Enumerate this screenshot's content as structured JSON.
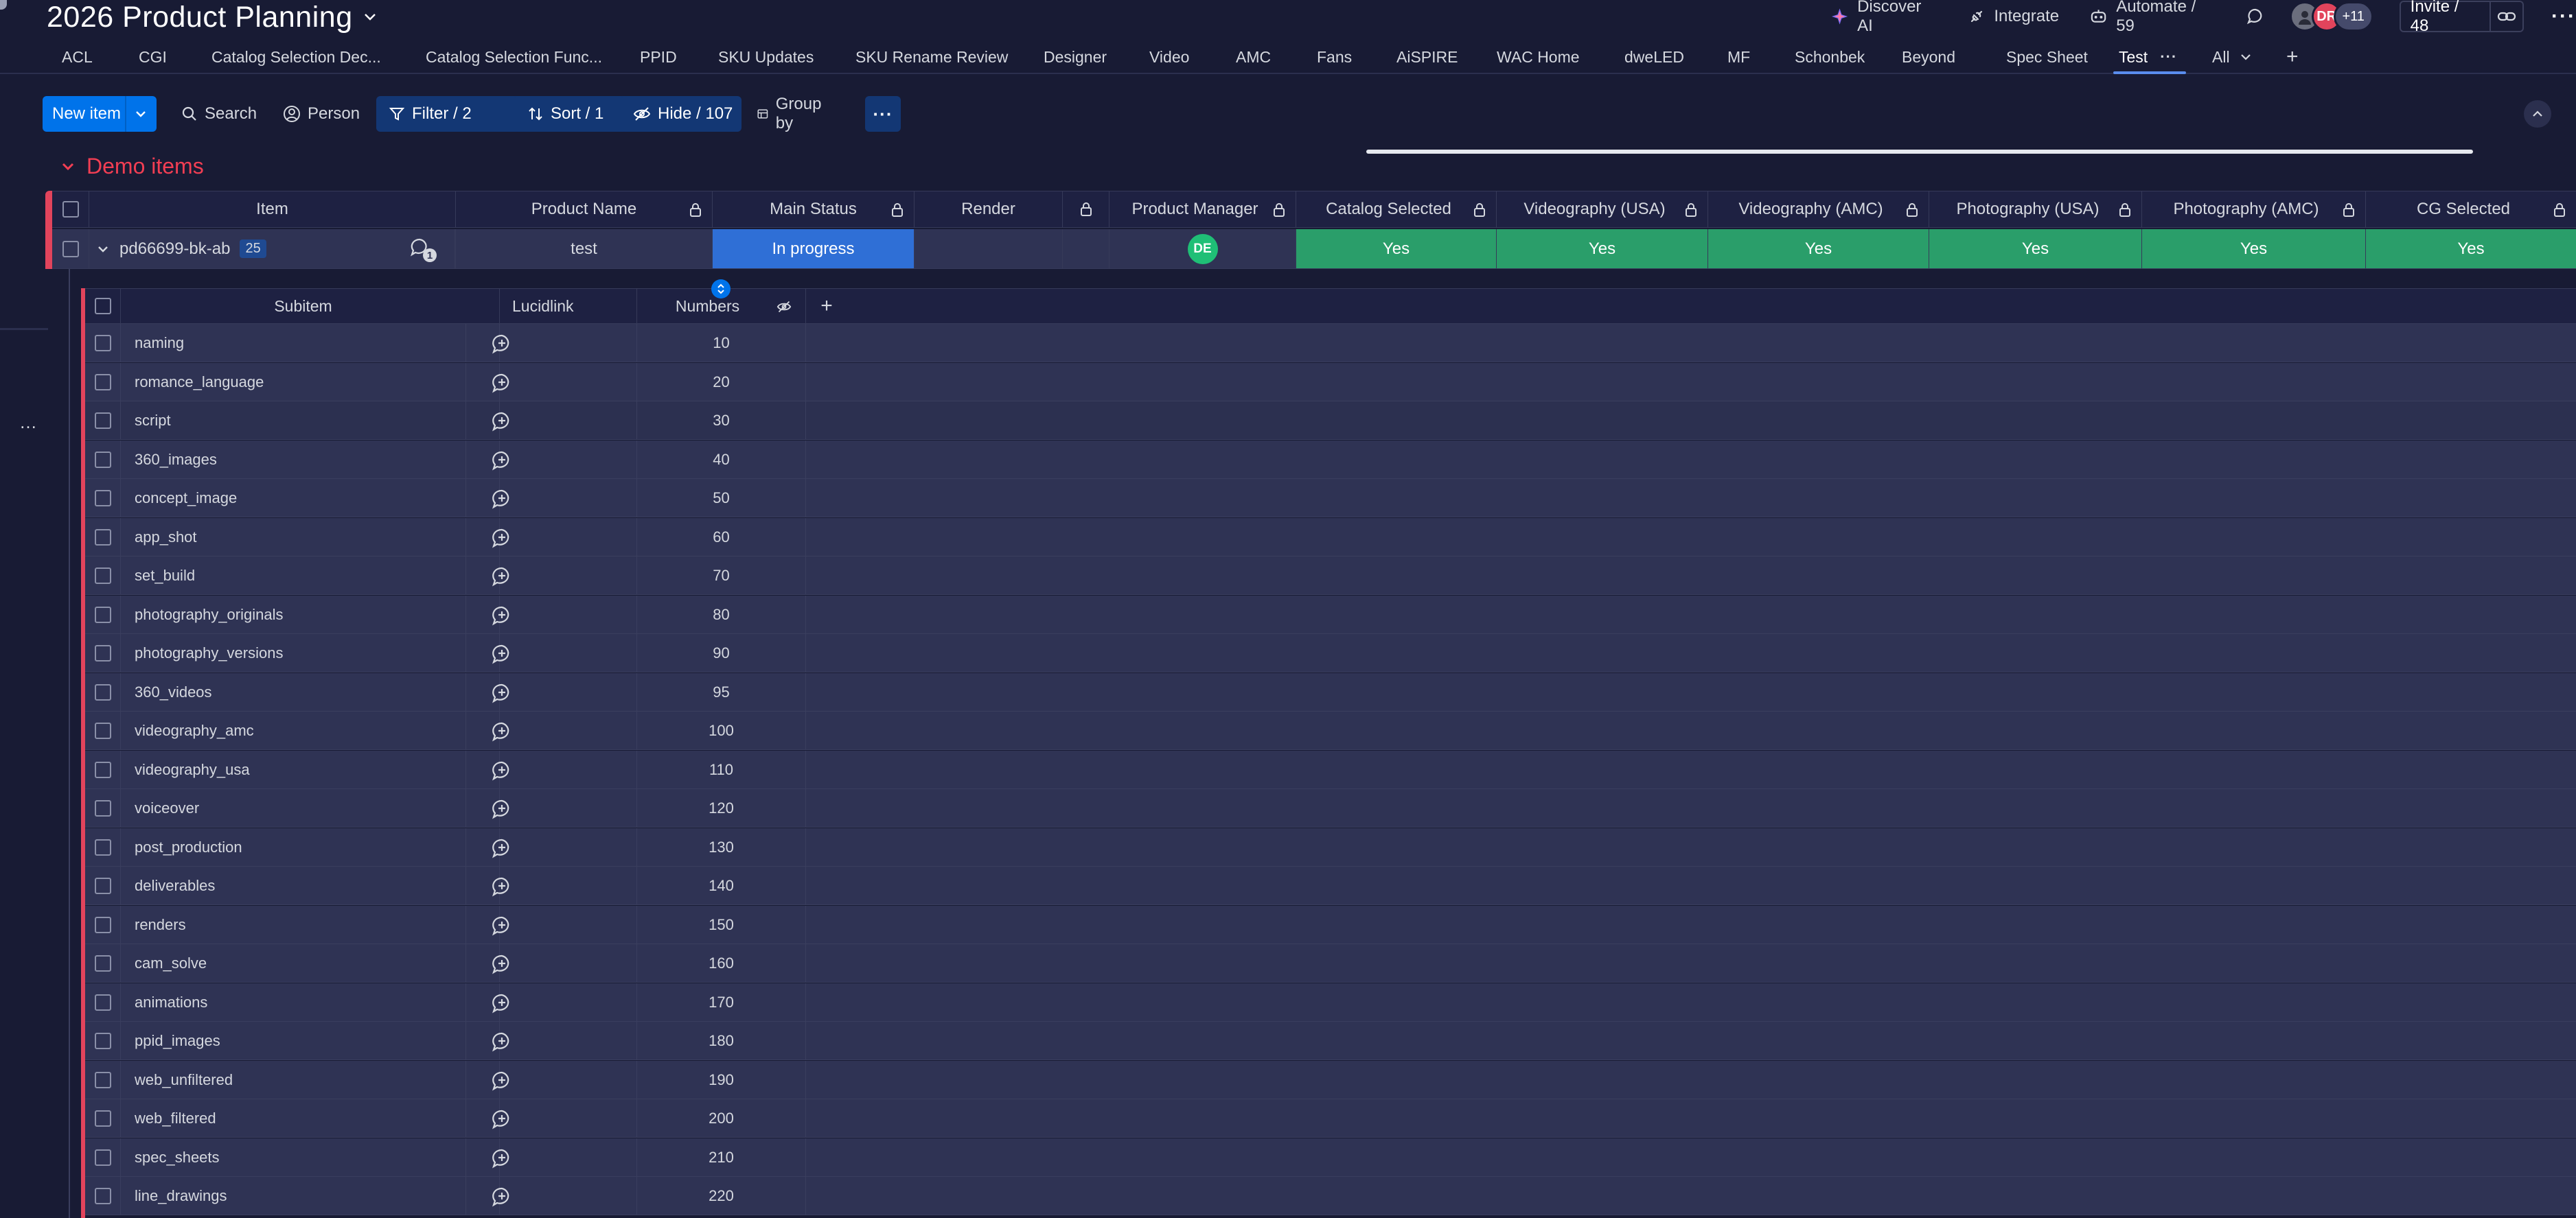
{
  "header": {
    "board_title": "2026 Product Planning",
    "discover_ai": "Discover AI",
    "integrate": "Integrate",
    "automate": "Automate / 59",
    "avatar_initials": "DR",
    "avatar_more": "+11",
    "invite": "Invite / 48"
  },
  "tabs": [
    "ACL",
    "CGI",
    "Catalog Selection Dec...",
    "Catalog Selection Func...",
    "PPID",
    "SKU Updates",
    "SKU Rename Review",
    "Designer",
    "Video",
    "AMC",
    "Fans",
    "AiSPIRE",
    "WAC Home",
    "dweLED",
    "MF",
    "Schonbek",
    "Beyond",
    "Spec Sheet",
    "Test",
    "All"
  ],
  "toolbar": {
    "new_item": "New item",
    "search": "Search",
    "person": "Person",
    "filter": "Filter / 2",
    "sort": "Sort / 1",
    "hide": "Hide / 107",
    "group_by": "Group by"
  },
  "group": {
    "title": "Demo items"
  },
  "columns": [
    "Item",
    "Product Name",
    "Main Status",
    "Render",
    "Product Manager",
    "Catalog Selected",
    "Videography (USA)",
    "Videography (AMC)",
    "Photography (USA)",
    "Photography (AMC)",
    "CG Selected"
  ],
  "item": {
    "name": "pd66699-bk-ab",
    "subitem_count": "25",
    "update_count": "1",
    "product_name": "test",
    "main_status": "In progress",
    "render": "",
    "manager_initials": "DE",
    "catalog_selected": "Yes",
    "videography_usa": "Yes",
    "videography_amc": "Yes",
    "photography_usa": "Yes",
    "photography_amc": "Yes",
    "cg_selected": "Yes"
  },
  "sub_columns": [
    "Subitem",
    "Lucidlink",
    "Numbers"
  ],
  "subitems": [
    {
      "name": "naming",
      "lucidlink": "",
      "number": "10"
    },
    {
      "name": "romance_language",
      "lucidlink": "",
      "number": "20"
    },
    {
      "name": "script",
      "lucidlink": "",
      "number": "30"
    },
    {
      "name": "360_images",
      "lucidlink": "",
      "number": "40"
    },
    {
      "name": "concept_image",
      "lucidlink": "",
      "number": "50"
    },
    {
      "name": "app_shot",
      "lucidlink": "",
      "number": "60"
    },
    {
      "name": "set_build",
      "lucidlink": "",
      "number": "70"
    },
    {
      "name": "photography_originals",
      "lucidlink": "",
      "number": "80"
    },
    {
      "name": "photography_versions",
      "lucidlink": "",
      "number": "90"
    },
    {
      "name": "360_videos",
      "lucidlink": "",
      "number": "95"
    },
    {
      "name": "videography_amc",
      "lucidlink": "",
      "number": "100"
    },
    {
      "name": "videography_usa",
      "lucidlink": "",
      "number": "110"
    },
    {
      "name": "voiceover",
      "lucidlink": "",
      "number": "120"
    },
    {
      "name": "post_production",
      "lucidlink": "",
      "number": "130"
    },
    {
      "name": "deliverables",
      "lucidlink": "",
      "number": "140"
    },
    {
      "name": "renders",
      "lucidlink": "",
      "number": "150"
    },
    {
      "name": "cam_solve",
      "lucidlink": "",
      "number": "160"
    },
    {
      "name": "animations",
      "lucidlink": "",
      "number": "170"
    },
    {
      "name": "ppid_images",
      "lucidlink": "",
      "number": "180"
    },
    {
      "name": "web_unfiltered",
      "lucidlink": "",
      "number": "190"
    },
    {
      "name": "web_filtered",
      "lucidlink": "",
      "number": "200"
    },
    {
      "name": "spec_sheets",
      "lucidlink": "",
      "number": "210"
    },
    {
      "name": "line_drawings",
      "lucidlink": "",
      "number": "220"
    }
  ],
  "colors": {
    "background": "#181b34",
    "primary": "#0073ea",
    "group": "#e2445c",
    "status_in_progress": "#2f6fd6",
    "yes": "#2a9e6a"
  }
}
